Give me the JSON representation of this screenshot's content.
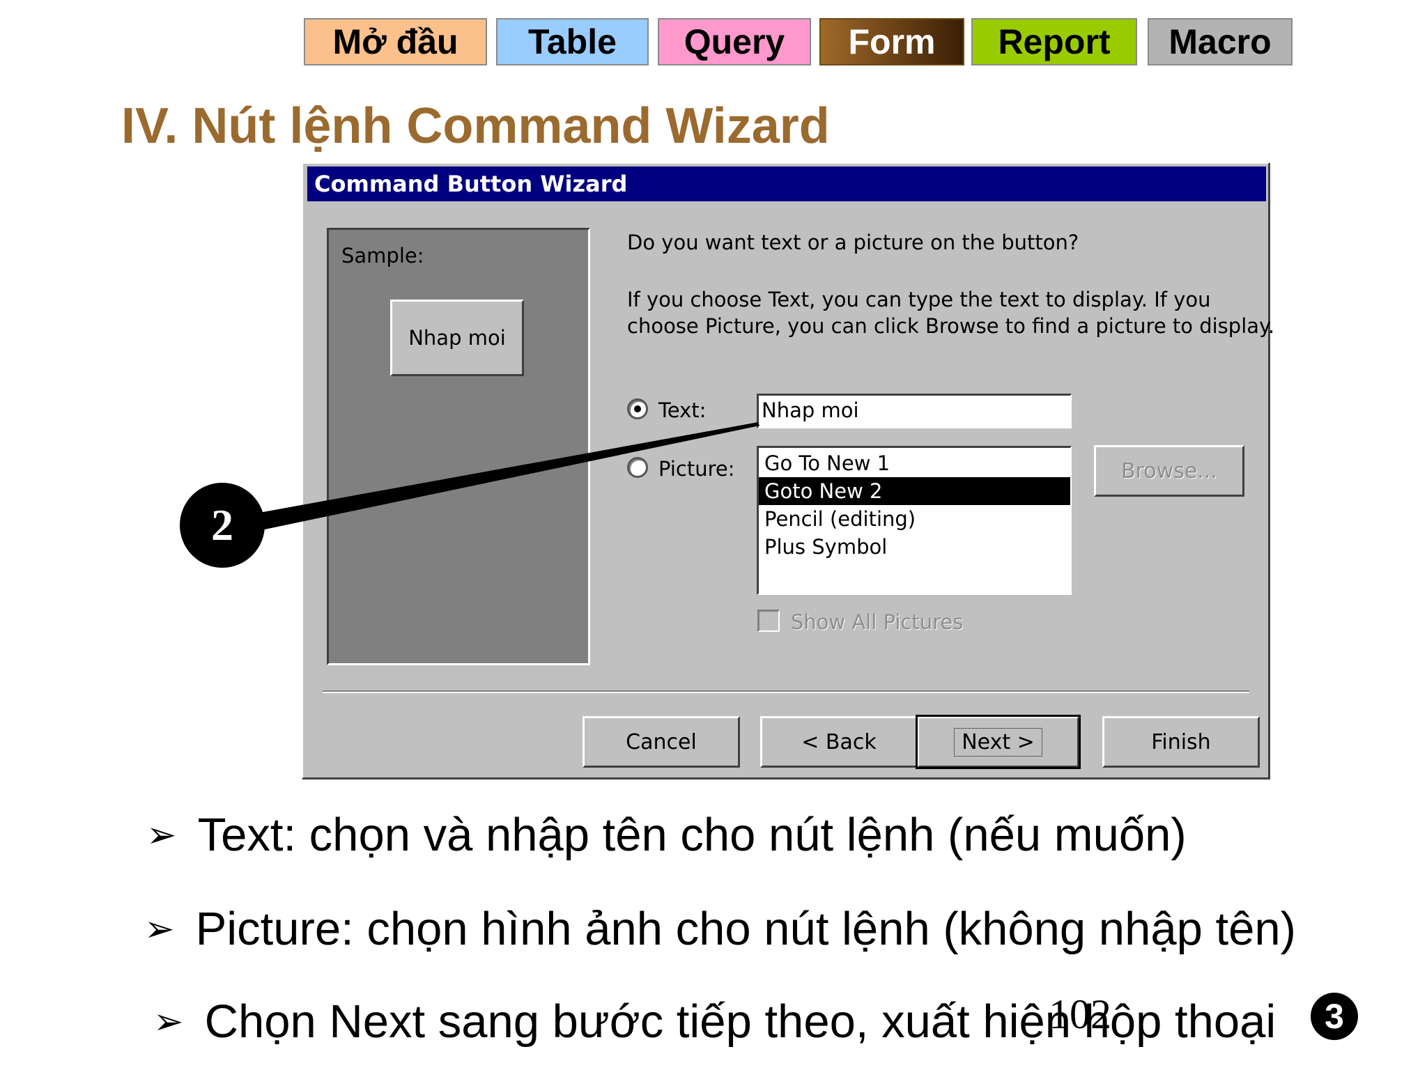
{
  "nav": {
    "tabs": [
      {
        "label": "Mở đầu",
        "color": "#fbc08c"
      },
      {
        "label": "Table",
        "color": "#99ccff"
      },
      {
        "label": "Query",
        "color": "#ff99cc"
      },
      {
        "label": "Form",
        "color": "#7a4a12"
      },
      {
        "label": "Report",
        "color": "#99cc00"
      },
      {
        "label": "Macro",
        "color": "#b3b3b3"
      }
    ]
  },
  "slide": {
    "title": "IV. Nút lệnh Command Wizard",
    "title_color": "#9b6a2e"
  },
  "dialog": {
    "title": "Command Button Wizard",
    "sample_label": "Sample:",
    "sample_button_text": "Nhap moi",
    "question": "Do you want text or a picture on the button?",
    "description_line1": "If you choose Text, you can type the text to display.  If you",
    "description_line2": "choose Picture, you can click Browse to find a picture to display.",
    "text_option_label": "Text:",
    "text_option_selected": true,
    "text_value": "Nhap moi",
    "picture_option_label": "Picture:",
    "picture_list": [
      "Go To New 1",
      "Goto New 2",
      "Pencil (editing)",
      "Plus Symbol"
    ],
    "picture_list_selected": "Goto New 2",
    "browse_button": "Browse...",
    "show_all_label": "Show All Pictures",
    "buttons": {
      "cancel": "Cancel",
      "back": "< Back",
      "next": "Next >",
      "finish": "Finish"
    }
  },
  "callout_number": "2",
  "bullets": [
    "Text: chọn và nhập tên cho nút lệnh (nếu muốn)",
    "Picture: chọn hình ảnh cho nút lệnh (không nhập tên)",
    "Chọn Next sang bước tiếp theo, xuất hiện hộp thoại"
  ],
  "page_number": "102",
  "step_badge": "3"
}
